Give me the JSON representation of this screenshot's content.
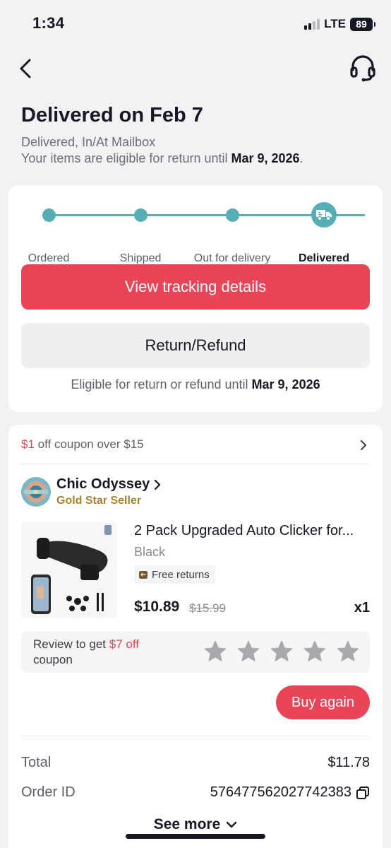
{
  "status_bar": {
    "time": "1:34",
    "network": "LTE",
    "battery": "89"
  },
  "header": {
    "title": "Delivered on Feb 7",
    "subtitle": "Delivered, In/At Mailbox",
    "return_prefix": "Your items are eligible for return until ",
    "return_date": "Mar 9, 2026",
    "return_suffix": "."
  },
  "tracking": {
    "steps": [
      {
        "label": "Ordered"
      },
      {
        "label": "Shipped"
      },
      {
        "label": "Out for delivery"
      },
      {
        "label": "Delivered"
      }
    ],
    "current_step": 4,
    "view_tracking_label": "View tracking details",
    "return_refund_label": "Return/Refund",
    "eligible_prefix": "Eligible for return or refund until ",
    "eligible_date": "Mar 9, 2026"
  },
  "order": {
    "coupon": {
      "amount": "$1",
      "text": " off coupon over $15"
    },
    "shop": {
      "name": "Chic Odyssey",
      "badge": "Gold Star Seller"
    },
    "product": {
      "name": "2 Pack Upgraded Auto Clicker for...",
      "variant": "Black",
      "free_returns": "Free returns",
      "price": "$10.89",
      "original_price": "$15.99",
      "quantity": "x1"
    },
    "review": {
      "prefix": "Review to get ",
      "amount": "$7 off",
      "suffix": "coupon",
      "stars": 5,
      "rating": 0
    },
    "buy_again_label": "Buy again",
    "total_label": "Total",
    "total_value": "$11.78",
    "order_id_label": "Order ID",
    "order_id_value": "576477562027742383",
    "see_more_label": "See more"
  },
  "colors": {
    "accent": "#ea4459",
    "progress": "#55aeb3",
    "gold": "#a0852e"
  }
}
